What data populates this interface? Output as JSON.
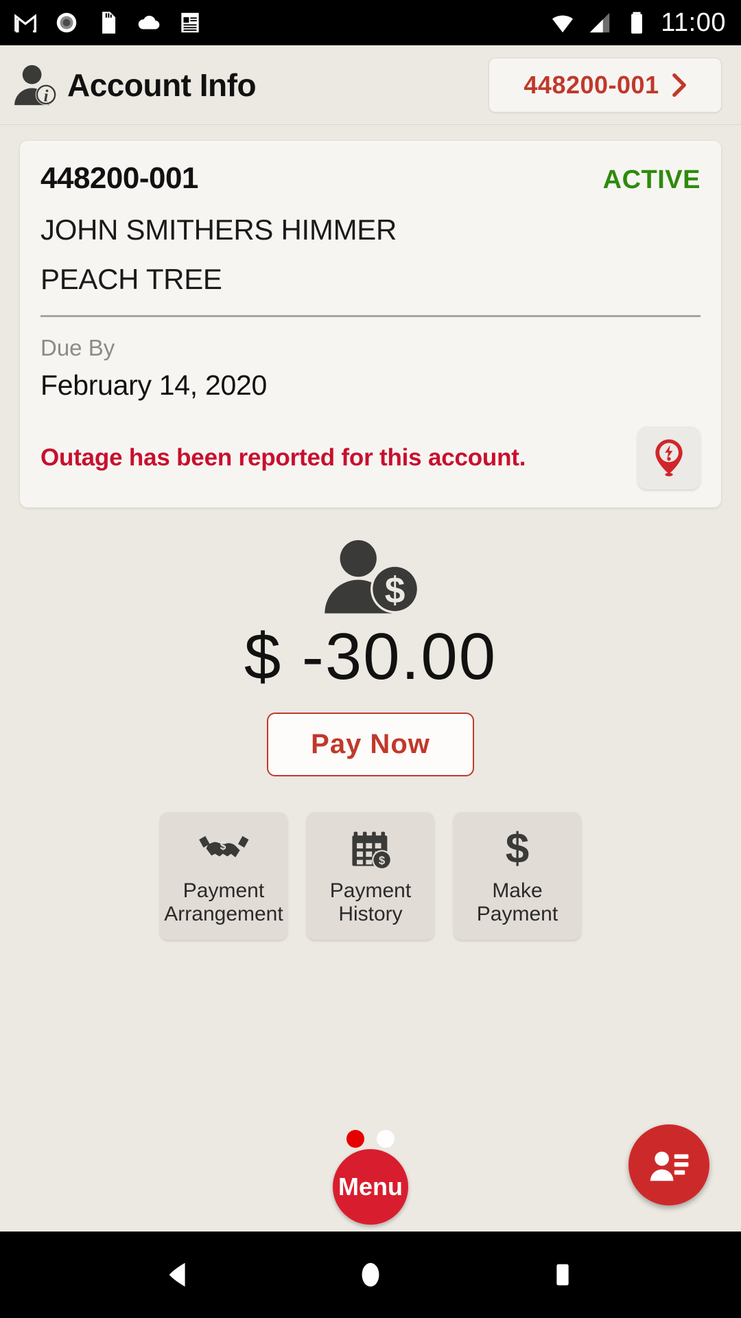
{
  "status_bar": {
    "icons": [
      "gmail-icon",
      "record-icon",
      "sd-card-icon",
      "cloud-icon",
      "notes-icon"
    ],
    "right_icons": [
      "wifi-icon",
      "cellular-signal-icon",
      "battery-icon"
    ],
    "clock": "11:00"
  },
  "header": {
    "icon": "account-info-person-icon",
    "title": "Account Info",
    "account_switcher": {
      "label": "448200-001",
      "chevron": "chevron-right-icon"
    }
  },
  "account_card": {
    "account_number": "448200-001",
    "status": "ACTIVE",
    "status_color": "#2e8b0b",
    "customer_name": "JOHN SMITHERS HIMMER",
    "address": "PEACH TREE",
    "due_by_label": "Due By",
    "due_by_value": "February 14, 2020",
    "outage_message": "Outage has been reported for this account.",
    "outage_message_color": "#c8102e",
    "outage_icon": "outage-pin-icon"
  },
  "balance": {
    "icon": "customer-balance-icon",
    "amount": "$ -30.00",
    "pay_now_label": "Pay Now",
    "pay_now_color": "#c0392b"
  },
  "action_tiles": [
    {
      "icon": "handshake-dollar-icon",
      "label": "Payment\nArrangement"
    },
    {
      "icon": "calendar-dollar-icon",
      "label": "Payment\nHistory"
    },
    {
      "icon": "dollar-sign-icon",
      "label": "Make\nPayment"
    }
  ],
  "pager": {
    "total": 2,
    "active_index": 0,
    "active_color": "#e60000",
    "inactive_color": "#ffffff"
  },
  "menu_button": {
    "label": "Menu",
    "color": "#d81e2e"
  },
  "contacts_fab": {
    "icon": "contact-list-icon",
    "color": "#cc2a2a"
  },
  "nav_bar": {
    "back": "back-triangle-icon",
    "home": "home-circle-icon",
    "recents": "recents-square-icon"
  },
  "theme": {
    "background": "#ece8e2",
    "card_background": "#f7f5f2",
    "accent_red": "#c0392b"
  }
}
